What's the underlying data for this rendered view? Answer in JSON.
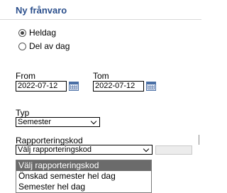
{
  "title": "Ny frånvaro",
  "radios": [
    {
      "label": "Heldag",
      "checked": true
    },
    {
      "label": "Del av dag",
      "checked": false
    }
  ],
  "from": {
    "label": "From",
    "value": "2022-07-12",
    "icon": "calendar-icon"
  },
  "tom": {
    "label": "Tom",
    "value": "2022-07-12",
    "icon": "calendar-icon"
  },
  "typ": {
    "label": "Typ",
    "value": "Semester"
  },
  "rapporteringskod": {
    "label": "Rapporteringskod",
    "value": "Välj rapporteringskod",
    "options": [
      "Välj rapporteringskod",
      "Önskad semester hel dag",
      "Semester hel dag"
    ],
    "selected_index": 0
  }
}
